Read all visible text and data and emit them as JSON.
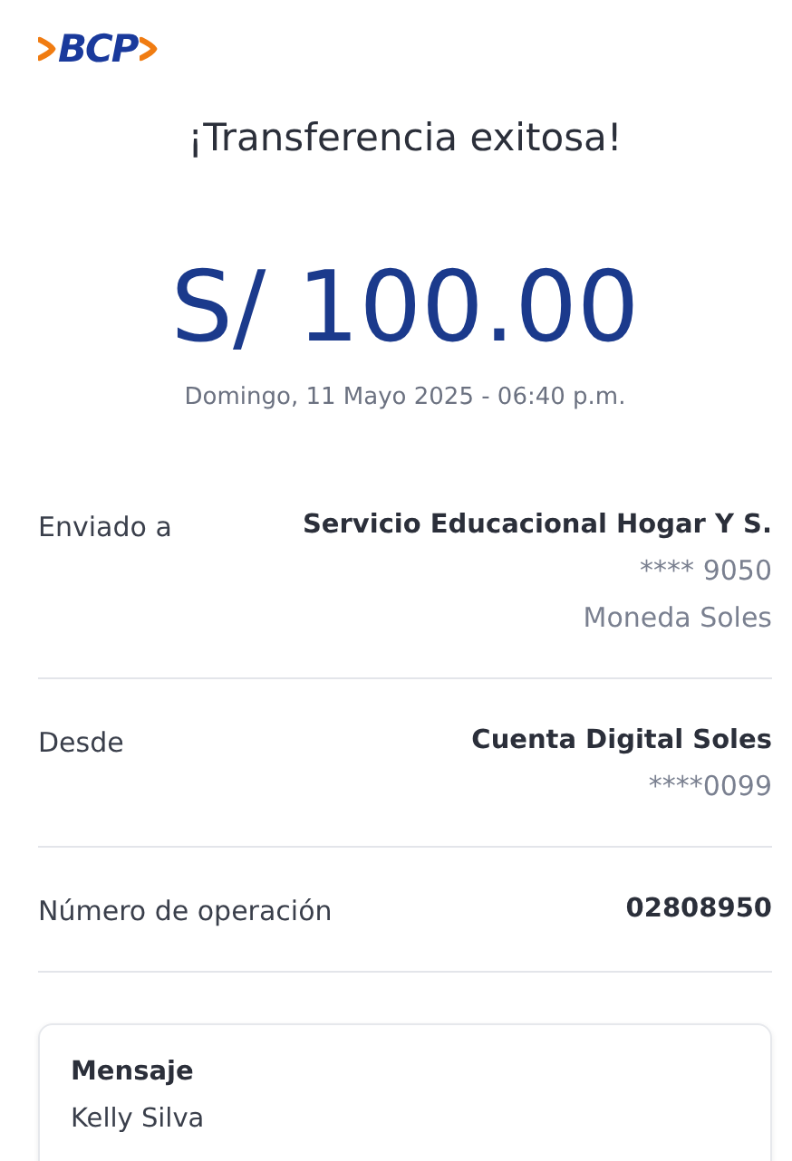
{
  "logo": {
    "text": "BCP"
  },
  "title": "¡Transferencia exitosa!",
  "amount": "S/ 100.00",
  "date": "Domingo, 11 Mayo 2025 - 06:40 p.m.",
  "details": [
    {
      "label": "Enviado a",
      "value": "Servicio Educacional Hogar Y S.",
      "extra": [
        "**** 9050",
        "Moneda Soles"
      ]
    },
    {
      "label": "Desde",
      "value": "Cuenta Digital Soles",
      "extra": [
        "****0099"
      ]
    },
    {
      "label": "Número de operación",
      "value": "02808950"
    }
  ],
  "message": {
    "title": "Mensaje",
    "text": "Kelly Silva"
  }
}
